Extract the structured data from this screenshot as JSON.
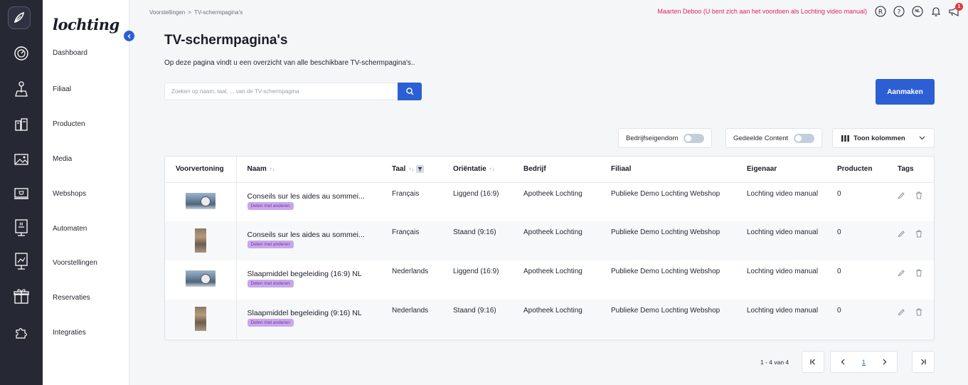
{
  "brand": "lochting",
  "sidebar": {
    "items": [
      {
        "label": "Dashboard",
        "icon": "dashboard-gauge-icon"
      },
      {
        "label": "Filiaal",
        "icon": "store-pin-icon"
      },
      {
        "label": "Producten",
        "icon": "products-icon"
      },
      {
        "label": "Media",
        "icon": "image-icon"
      },
      {
        "label": "Webshops",
        "icon": "webshop-icon"
      },
      {
        "label": "Automaten",
        "icon": "vending-machine-icon"
      },
      {
        "label": "Voorstellingen",
        "icon": "presentation-icon"
      },
      {
        "label": "Reservaties",
        "icon": "gift-icon"
      },
      {
        "label": "Integraties",
        "icon": "puzzle-icon"
      }
    ]
  },
  "breadcrumb": {
    "items": [
      "Voorstellingen",
      "TV-schermpagina's"
    ],
    "separator": ">"
  },
  "topbar": {
    "impersonation": "Maarten Deboo (U bent zich aan het voordoen als Lochting video manual)",
    "lang": "NL",
    "notification_count": "1"
  },
  "page": {
    "title": "TV-schermpagina's",
    "subtitle": "Op deze pagina vindt u een overzicht van alle beschikbare TV-schermpagina's.."
  },
  "search": {
    "placeholder": "Zoeken op naam, taal, ... van de TV-schermpagina",
    "value": ""
  },
  "create_label": "Aanmaken",
  "filters": {
    "company_owned": "Bedrijfseigendom",
    "shared_content": "Gedeelde Content",
    "show_columns": "Toon kolommen"
  },
  "table": {
    "headers": [
      "Voorvertoning",
      "Naam",
      "Taal",
      "Oriëntatie",
      "Bedrijf",
      "Filiaal",
      "Eigenaar",
      "Producten",
      "Tags"
    ],
    "rows": [
      {
        "thumb": "landscape",
        "name": "Conseils sur les aides au sommei...",
        "badge": "Delen met anderen",
        "taal": "Français",
        "orientatie": "Liggend (16:9)",
        "bedrijf": "Apotheek Lochting",
        "filiaal": "Publieke Demo Lochting Webshop",
        "eigenaar": "Lochting video manual",
        "producten": "0"
      },
      {
        "thumb": "portrait",
        "name": "Conseils sur les aides au sommei...",
        "badge": "Delen met anderen",
        "taal": "Français",
        "orientatie": "Staand (9:16)",
        "bedrijf": "Apotheek Lochting",
        "filiaal": "Publieke Demo Lochting Webshop",
        "eigenaar": "Lochting video manual",
        "producten": "0"
      },
      {
        "thumb": "landscape",
        "name": "Slaapmiddel begeleiding (16:9) NL",
        "badge": "Delen met anderen",
        "taal": "Nederlands",
        "orientatie": "Liggend (16:9)",
        "bedrijf": "Apotheek Lochting",
        "filiaal": "Publieke Demo Lochting Webshop",
        "eigenaar": "Lochting video manual",
        "producten": "0"
      },
      {
        "thumb": "portrait",
        "name": "Slaapmiddel begeleiding (9:16) NL",
        "badge": "Delen met anderen",
        "taal": "Nederlands",
        "orientatie": "Staand (9:16)",
        "bedrijf": "Apotheek Lochting",
        "filiaal": "Publieke Demo Lochting Webshop",
        "eigenaar": "Lochting video manual",
        "producten": "0"
      }
    ]
  },
  "pagination": {
    "info": "1 - 4 van 4",
    "current": "1"
  },
  "colors": {
    "accent": "#2c5fd4",
    "rail": "#262833",
    "badge_bg": "#c9a7ea",
    "alert": "#d72660"
  }
}
